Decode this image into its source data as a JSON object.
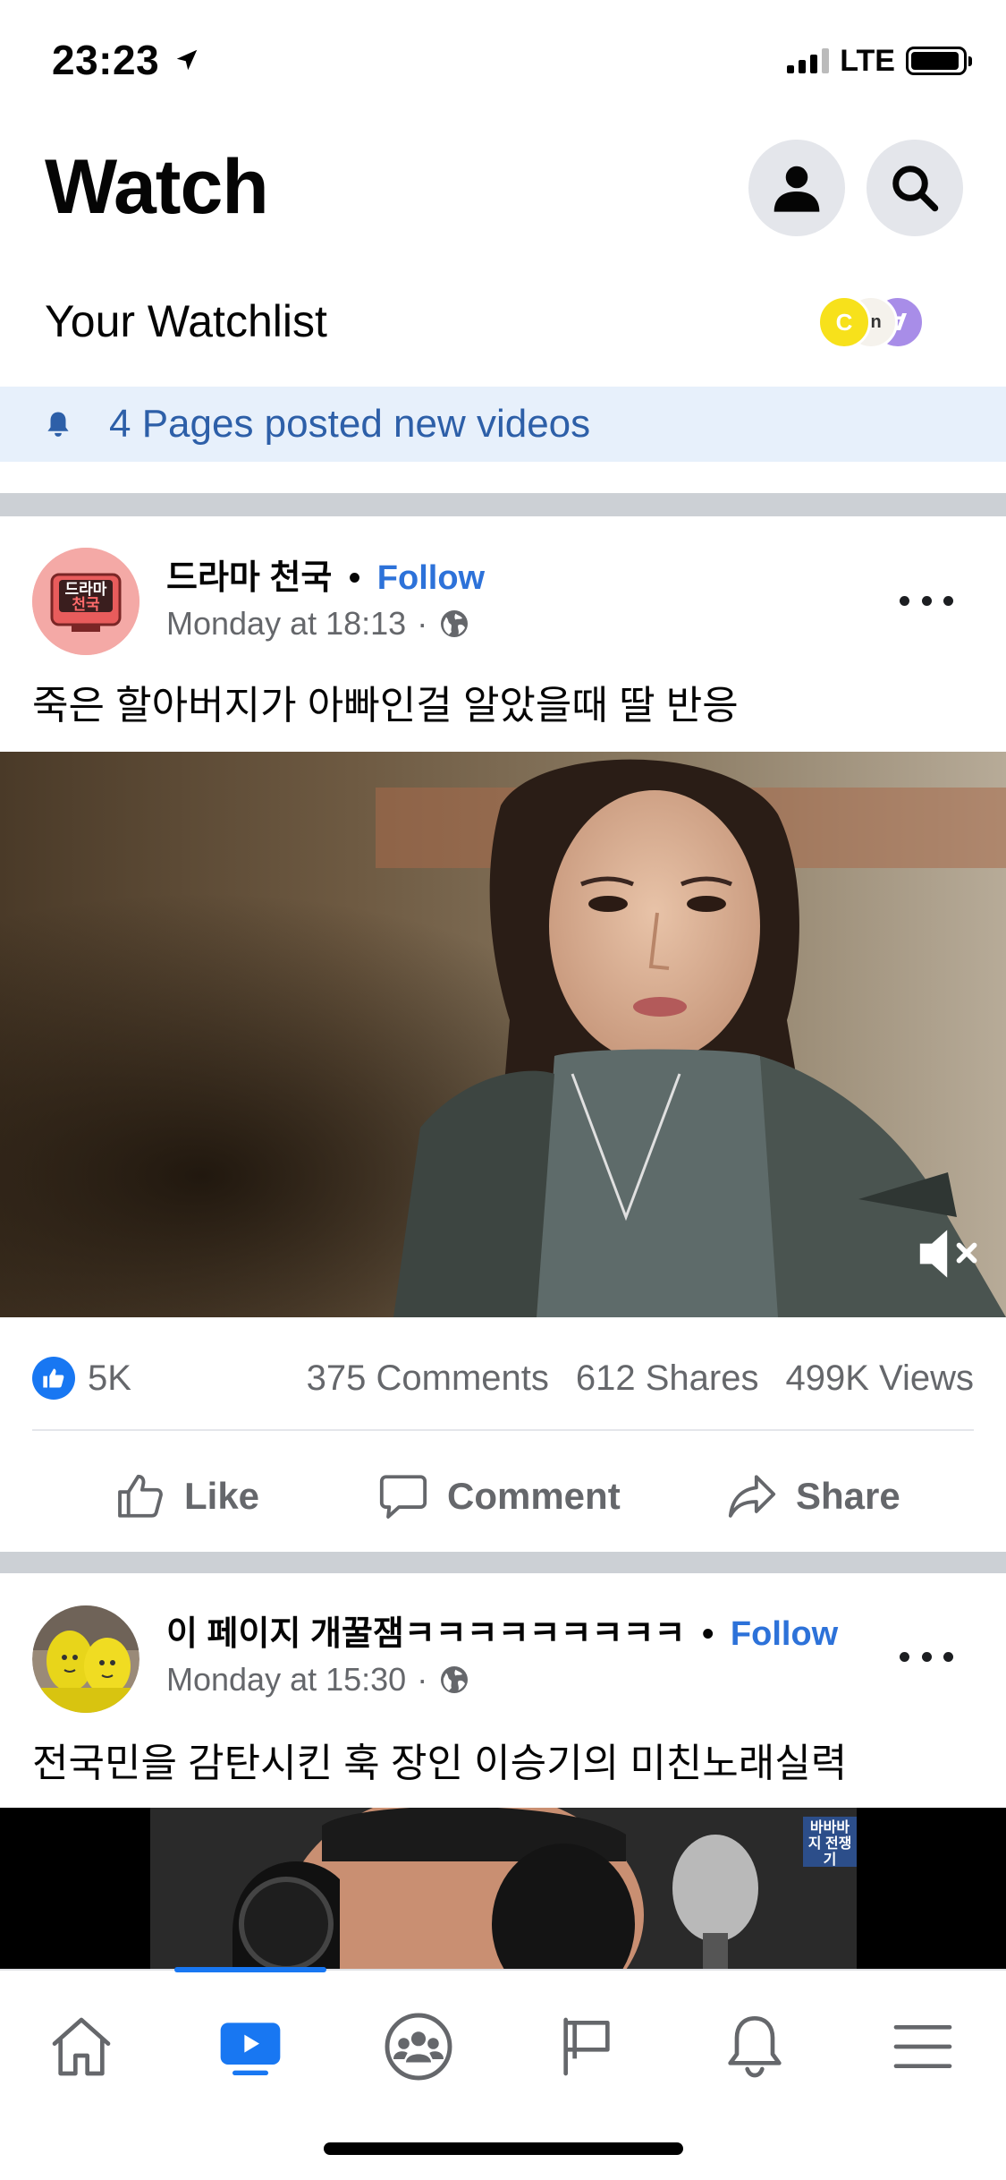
{
  "status_bar": {
    "time": "23:23",
    "network": "LTE",
    "battery_level": 0.95,
    "signal_bars": 3
  },
  "header": {
    "title": "Watch",
    "profile_icon": "person-icon",
    "search_icon": "search-icon"
  },
  "watchlist": {
    "label": "Your Watchlist",
    "avatar_letters": [
      "C",
      ".ın",
      "Ɐ"
    ]
  },
  "notice": {
    "text": "4 Pages posted new videos",
    "icon": "bell-icon"
  },
  "posts": [
    {
      "page_name": "드라마 천국",
      "follow_label": "Follow",
      "separator": "•",
      "time": "Monday at 18:13",
      "meta_separator": "·",
      "privacy_icon": "globe-icon",
      "caption": "죽은 할아버지가 아빠인걸 알았을때 딸 반응",
      "avatar_text_top": "드라마",
      "avatar_text_bottom": "천국",
      "video_muted": true
    },
    {
      "page_name": "이 페이지 개꿀잼ㅋㅋㅋㅋㅋㅋㅋㅋㅋ",
      "follow_label": "Follow",
      "separator": "•",
      "time": "Monday at 15:30",
      "meta_separator": "·",
      "privacy_icon": "globe-icon",
      "caption": "전국민을 감탄시킨 훅 장인 이승기의 미친노래실력",
      "video_overlay_text": "바바바지 전쟁기"
    }
  ],
  "stats": {
    "likes": "5K",
    "comments": "375 Comments",
    "shares": "612 Shares",
    "views": "499K Views"
  },
  "actions": {
    "like": "Like",
    "comment": "Comment",
    "share": "Share"
  },
  "tabbar": {
    "active_tab": "watch",
    "tabs": [
      "home-icon",
      "watch-icon",
      "groups-icon",
      "pages-flag-icon",
      "notifications-bell-icon",
      "menu-icon"
    ]
  },
  "colors": {
    "accent": "#1877f2",
    "follow": "#2d72d9",
    "notice_bg": "#e7f0fb",
    "notice_text": "#2d5fa8",
    "divider": "#ccd0d5",
    "secondary_text": "#65676b"
  }
}
